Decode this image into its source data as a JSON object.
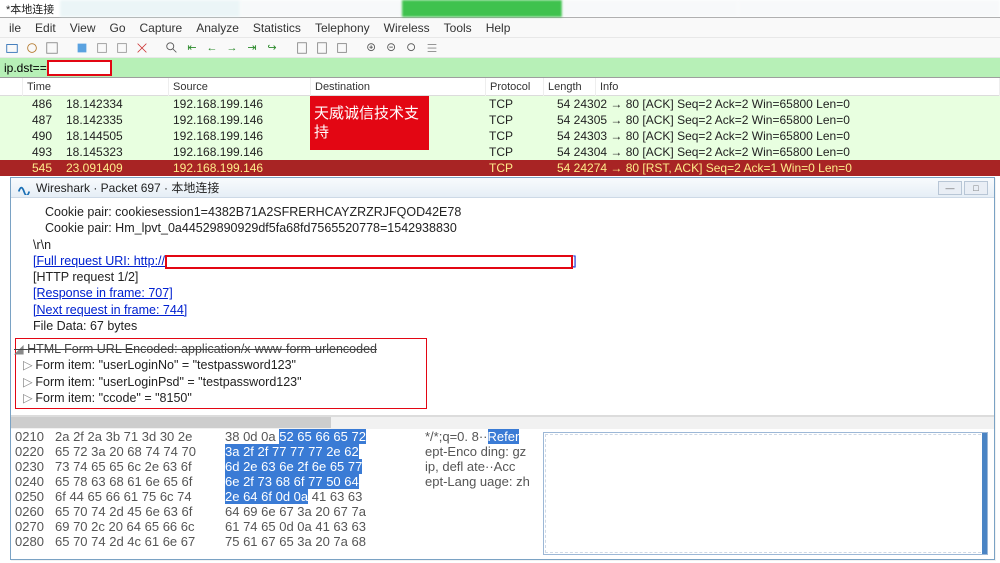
{
  "window": {
    "local_conn": "*本地连接"
  },
  "menu": {
    "file": "ile",
    "edit": "Edit",
    "view": "View",
    "go": "Go",
    "capture": "Capture",
    "analyze": "Analyze",
    "statistics": "Statistics",
    "telephony": "Telephony",
    "wireless": "Wireless",
    "tools": "Tools",
    "help": "Help"
  },
  "filter": {
    "prefix": "ip.dst=="
  },
  "columns": {
    "no": "",
    "time": "Time",
    "source": "Source",
    "destination": "Destination",
    "protocol": "Protocol",
    "length": "Length",
    "info": "Info"
  },
  "overlay_label": "天威诚信技术支持",
  "rows": [
    {
      "no": "486",
      "time": "18.142334",
      "src": "192.168.199.146",
      "dst": "",
      "proto": "TCP",
      "rest": "54 24302 → 80 [ACK] Seq=2 Ack=2 Win=65800 Len=0",
      "cls": "light"
    },
    {
      "no": "487",
      "time": "18.142335",
      "src": "192.168.199.146",
      "dst": "",
      "proto": "TCP",
      "rest": "54 24305 → 80 [ACK] Seq=2 Ack=2 Win=65800 Len=0",
      "cls": "light"
    },
    {
      "no": "490",
      "time": "18.144505",
      "src": "192.168.199.146",
      "dst": "",
      "proto": "TCP",
      "rest": "54 24303 → 80 [ACK] Seq=2 Ack=2 Win=65800 Len=0",
      "cls": "light"
    },
    {
      "no": "493",
      "time": "18.145323",
      "src": "192.168.199.146",
      "dst": "",
      "proto": "TCP",
      "rest": "54 24304 → 80 [ACK] Seq=2 Ack=2 Win=65800 Len=0",
      "cls": "light"
    },
    {
      "no": "545",
      "time": "23.091409",
      "src": "192.168.199.146",
      "dst": "",
      "proto": "TCP",
      "rest": "54 24274 → 80 [RST, ACK] Seq=2 Ack=1 Win=0 Len=0",
      "cls": "dark"
    }
  ],
  "popup": {
    "title": "Wireshark · Packet 697 · 本地连接",
    "cookie_pair_1": "Cookie pair: cookiesession1=4382B71A2SFRERHCAYZRZRJFQOD42E78",
    "cookie_pair_2": "Cookie pair: Hm_lpvt_0a44529890929df5fa68fd7565520778=1542938830",
    "crlf": "\\r\\n",
    "full_uri_label": "[Full request URI: http://",
    "full_uri_close": "]",
    "http_req": "[HTTP request 1/2]",
    "resp_frame": "[Response in frame: 707]",
    "next_req": "[Next request in frame: 744]",
    "file_data": "File Data: 67 bytes",
    "form_header": "HTML Form URL Encoded: application/x-www-form-urlencoded",
    "form_items": [
      "Form item: \"userLoginNo\" = \"testpassword123\"",
      "Form item: \"userLoginPsd\" = \"testpassword123\"",
      "Form item: \"ccode\" = \"8150\""
    ]
  },
  "hex": {
    "offsets": [
      "0210",
      "0220",
      "0230",
      "0240",
      "0250",
      "0260",
      "0270",
      "0280"
    ],
    "left": [
      "2a 2f 2a 3b 71 3d 30 2e",
      "65 72 3a 20 68 74 74 70",
      "73 74 65 65 6c 2e 63 6f",
      "65 78 63 68 61 6e 65 6f",
      "6f 44 65 66 61 75 6c 74",
      "65 70 74 2d 45 6e 63 6f",
      "69 70 2c 20 64 65 66 6c",
      "65 70 74 2d 4c 61 6e 67"
    ],
    "right_plain": [
      "38 0d 0a ",
      "",
      "",
      "",
      "",
      "64 69 6e 67 3a 20 67 7a",
      "61 74 65 0d 0a 41 63 63",
      "75 61 67 65 3a 20 7a 68"
    ],
    "right_hi": [
      "52 65 66 65 72",
      "3a 2f 2f 77 77 77 2e 62",
      "6d 2e 63 6e 2f 6e 65 77",
      "6e 2f 73 68 6f 77 50 64",
      "2e 64 6f 0d 0a",
      "",
      "",
      ""
    ],
    "right_tail": [
      "",
      "",
      "",
      "",
      "41 63 63",
      "",
      "",
      ""
    ],
    "ascii_plain": [
      "*/*;q=0. 8··",
      "",
      "",
      "",
      "",
      "ept-Enco ding: gz",
      "ip, defl ate··Acc",
      "ept-Lang uage: zh"
    ],
    "ascii_hi": [
      "Refer",
      "",
      "",
      "",
      "",
      "",
      "",
      ""
    ]
  }
}
